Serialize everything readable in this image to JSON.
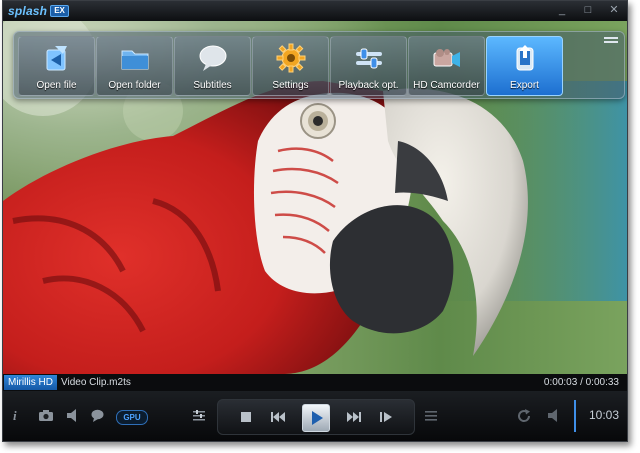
{
  "app": {
    "logo_text": "splash",
    "logo_badge": "EX",
    "window_buttons": [
      "_",
      "□",
      "✕"
    ]
  },
  "menu": {
    "items": [
      {
        "label": "Open file",
        "icon": "open-file-icon"
      },
      {
        "label": "Open folder",
        "icon": "folder-icon"
      },
      {
        "label": "Subtitles",
        "icon": "speech-bubble-icon"
      },
      {
        "label": "Settings",
        "icon": "gear-icon"
      },
      {
        "label": "Playback opt.",
        "icon": "slider-icon"
      },
      {
        "label": "HD Camcorder",
        "icon": "camcorder-icon"
      },
      {
        "label": "Export",
        "icon": "export-icon",
        "active": true
      }
    ]
  },
  "infobar": {
    "tag": "Mirillis HD",
    "filename": "Video Clip.m2ts",
    "time": "0:00:03 / 0:00:33"
  },
  "controls": {
    "gpu_label": "GPU",
    "clock": "10:03",
    "accent": "#3f8fe8"
  }
}
